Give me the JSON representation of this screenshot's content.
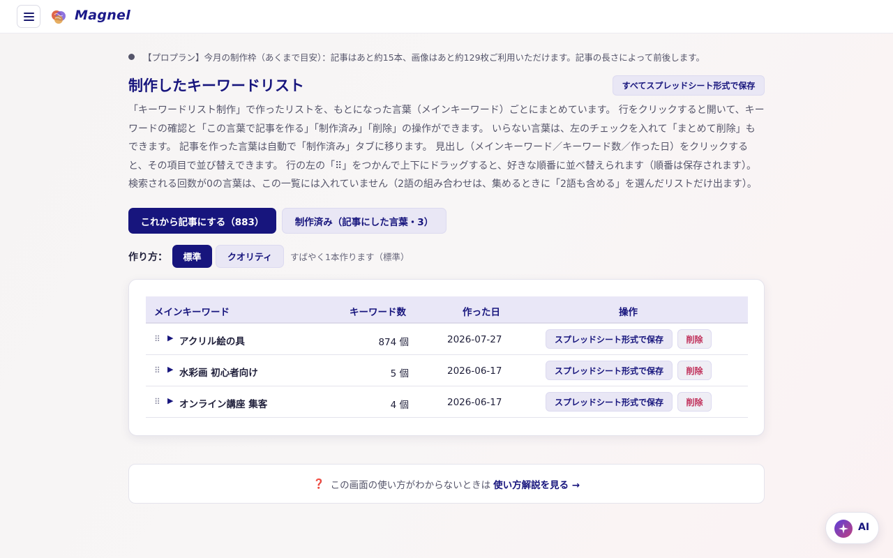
{
  "app": {
    "name": "Magnel"
  },
  "notice": {
    "text": "【プロプラン】今月の制作枠（あくまで目安）：記事はあと約15本、画像はあと約129枚ご利用いただけます。記事の長さによって前後します。"
  },
  "page": {
    "title": "制作したキーワードリスト",
    "save_all_label": "すべてスプレッドシート形式で保存",
    "description": "「キーワードリスト制作」で作ったリストを、もとになった言葉（メインキーワード）ごとにまとめています。 行をクリックすると開いて、キーワードの確認と「この言葉で記事を作る」「制作済み」「削除」の操作ができます。 いらない言葉は、左のチェックを入れて「まとめて削除」もできます。 記事を作った言葉は自動で「制作済み」タブに移ります。 見出し（メインキーワード／キーワード数／作った日）をクリックすると、その項目で並び替えできます。 行の左の「⠿」をつかんで上下にドラッグすると、好きな順番に並べ替えられます（順番は保存されます）。 検索される回数が0の言葉は、この一覧には入れていません（2語の組み合わせは、集めるときに「2語も含める」を選んだリストだけ出ます）。"
  },
  "tabs": [
    {
      "label": "これから記事にする（883）"
    },
    {
      "label": "制作済み（記事にした言葉・3）"
    }
  ],
  "mode": {
    "label": "作り方：",
    "options": [
      "標準",
      "クオリティ"
    ],
    "note": "すばやく1本作ります（標準）"
  },
  "table": {
    "headers": {
      "main_keyword": "メインキーワード",
      "keyword_count": "キーワード数",
      "created": "作った日",
      "actions": "操作"
    },
    "rows": [
      {
        "keyword": "アクリル絵の具",
        "count": "874 個",
        "date": "2026-07-27",
        "save": "スプレッドシート形式で保存",
        "delete": "削除"
      },
      {
        "keyword": "水彩画 初心者向け",
        "count": "5 個",
        "date": "2026-06-17",
        "save": "スプレッドシート形式で保存",
        "delete": "削除"
      },
      {
        "keyword": "オンライン講座 集客",
        "count": "4 個",
        "date": "2026-06-17",
        "save": "スプレッドシート形式で保存",
        "delete": "削除"
      }
    ],
    "drag_glyph": "⠿",
    "expand_glyph": "▶"
  },
  "help": {
    "icon": "❓",
    "text": "この画面の使い方がわからないときは",
    "link": "使い方解説を見る →"
  },
  "ai_button": {
    "label": "AI"
  },
  "colors": {
    "primary": "#17157d",
    "secondary_bg": "#e9e7f5",
    "danger": "#c0305a"
  }
}
